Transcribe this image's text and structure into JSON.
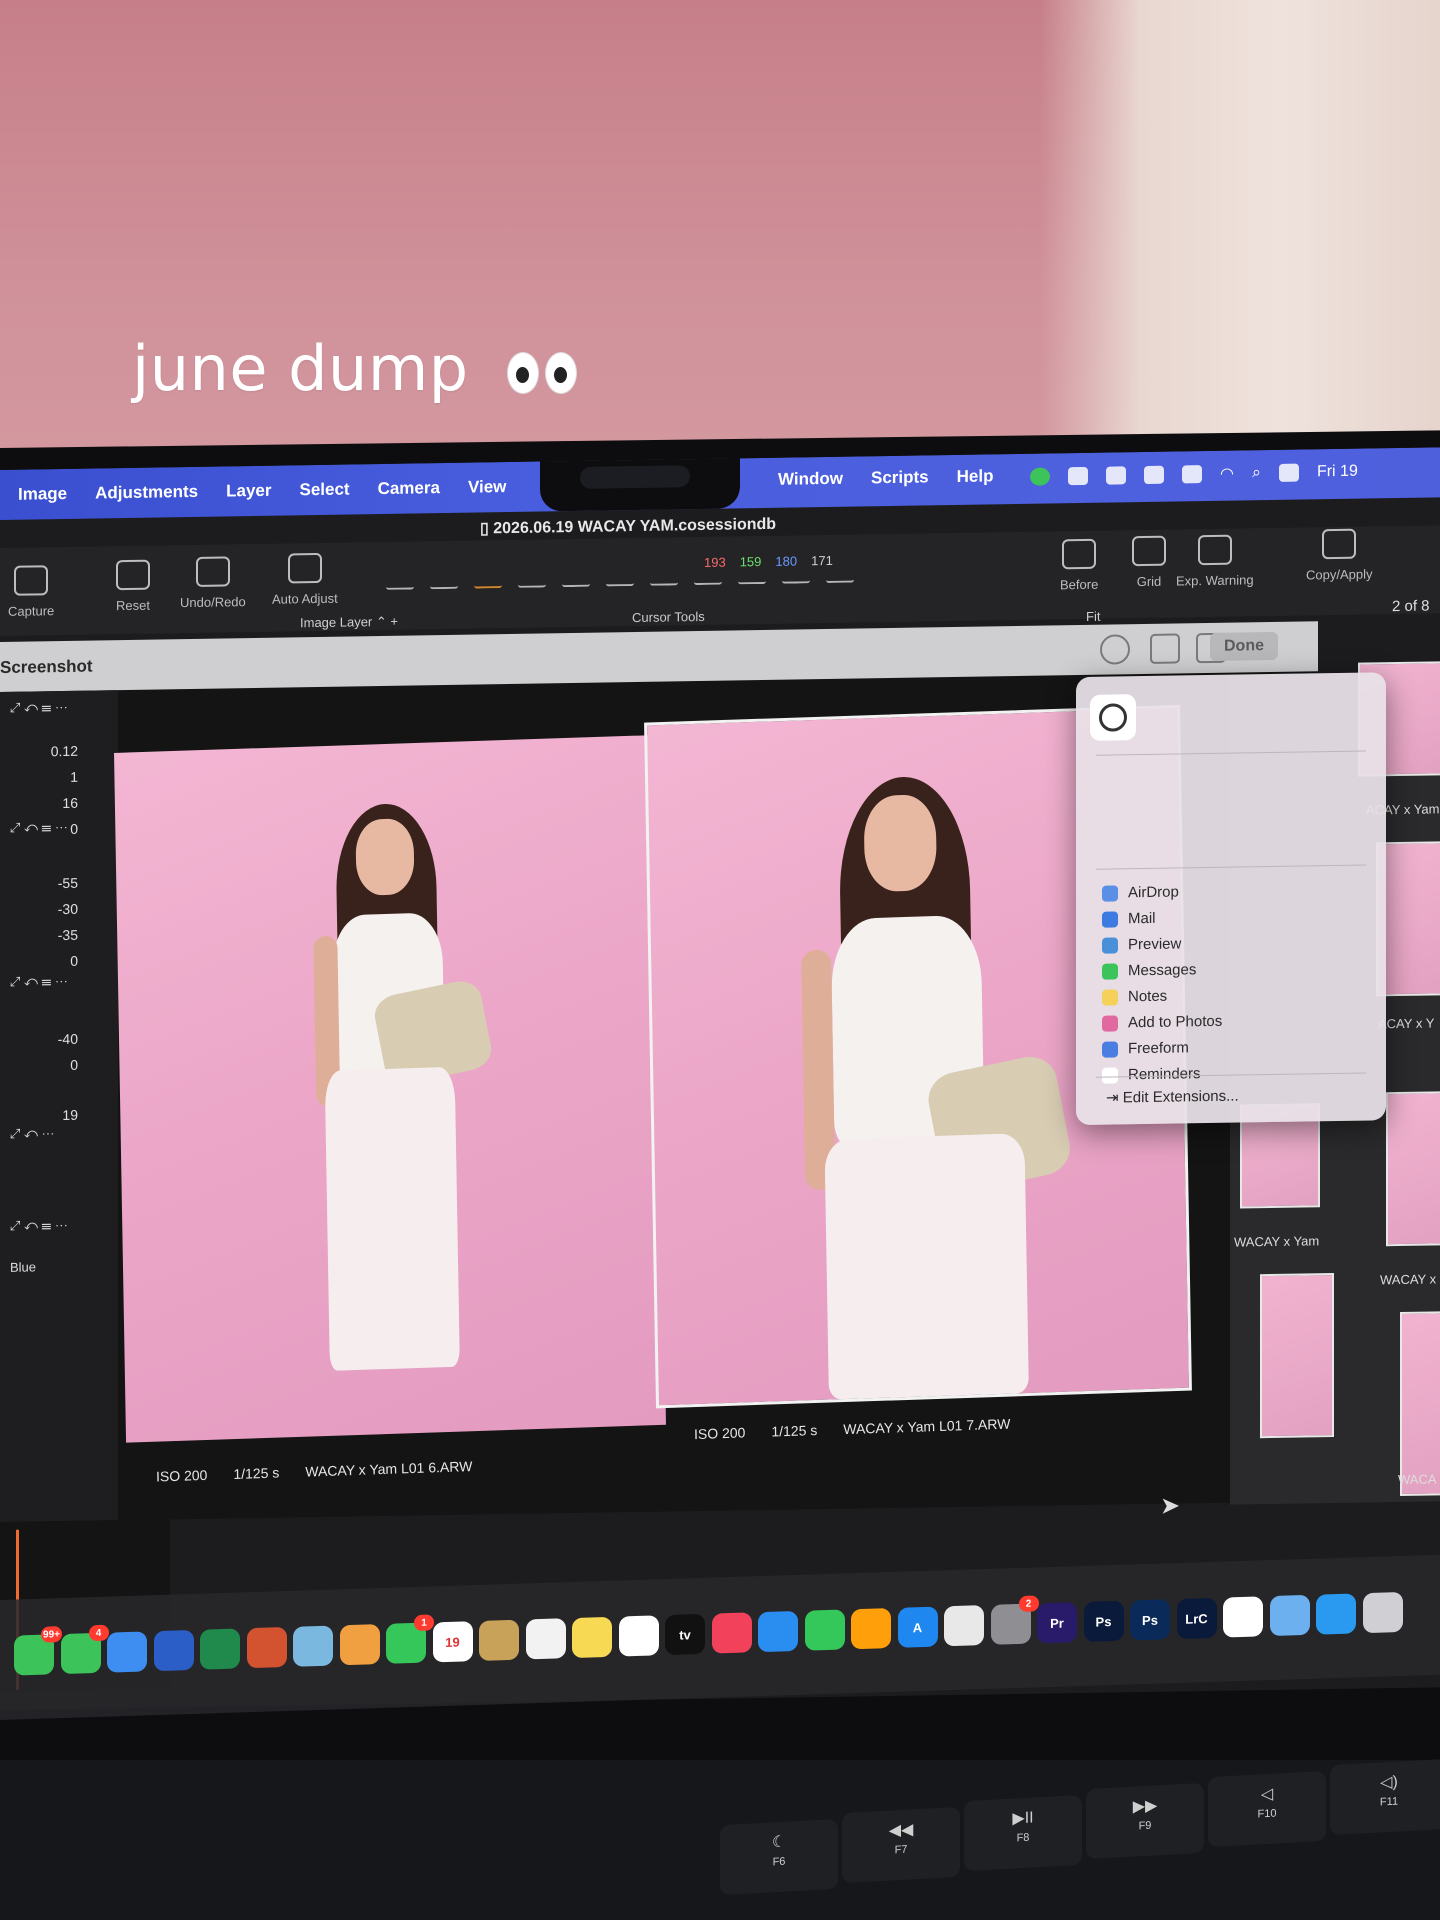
{
  "caption": "june dump",
  "menu": {
    "left": [
      "Image",
      "Adjustments",
      "Layer",
      "Select",
      "Camera",
      "View"
    ],
    "right": [
      "Window",
      "Scripts",
      "Help"
    ],
    "clock": "Fri 19"
  },
  "document_title": "2026.06.19 WACAY YAM.cosessiondb",
  "toolbar": {
    "groups": [
      {
        "label": "Capture"
      },
      {
        "label": "Reset"
      },
      {
        "label": "Undo/Redo"
      },
      {
        "label": "Auto Adjust"
      },
      {
        "label": "Before"
      },
      {
        "label": "Grid"
      },
      {
        "label": "Exp. Warning"
      },
      {
        "label": "Copy/Apply"
      }
    ],
    "cursor_tools_label": "Cursor Tools",
    "rgb_readout": {
      "r": "193",
      "g": "159",
      "b": "180",
      "a": "171"
    },
    "image_layer_label": "Image Layer",
    "fit_label": "Fit",
    "page_count": "2 of 8"
  },
  "viewer": {
    "title": "Screenshot",
    "done_label": "Done",
    "left_values": [
      "0.12",
      "1",
      "16",
      "0",
      "-55",
      "-30",
      "-35",
      "0",
      "-40",
      "0",
      "19"
    ],
    "channel_label": "Blue",
    "photos": [
      {
        "iso": "ISO 200",
        "shutter": "1/125 s",
        "filename": "WACAY x Yam L01 6.ARW"
      },
      {
        "iso": "ISO 200",
        "shutter": "1/125 s",
        "filename": "WACAY x Yam L01 7.ARW"
      }
    ],
    "filmstrip_labels": [
      "ACAY x Yam",
      "ACAY x Y",
      "WACAY x Yam",
      "WACAY x",
      "WACA"
    ]
  },
  "share_menu": {
    "items": [
      {
        "label": "AirDrop",
        "color": "#5a8fe6"
      },
      {
        "label": "Mail",
        "color": "#3d7be0"
      },
      {
        "label": "Preview",
        "color": "#4a90d9"
      },
      {
        "label": "Messages",
        "color": "#3cc35a"
      },
      {
        "label": "Notes",
        "color": "#f5d15a"
      },
      {
        "label": "Add to Photos",
        "color": "#e06aa0"
      },
      {
        "label": "Freeform",
        "color": "#4a7ee0"
      },
      {
        "label": "Reminders",
        "color": "#ffffff"
      }
    ],
    "edit_extensions": "Edit Extensions..."
  },
  "dock": {
    "icons": [
      {
        "name": "line",
        "label": "",
        "color": "#3cc35a",
        "badge": "99+"
      },
      {
        "name": "messages",
        "label": "",
        "color": "#3cc35a",
        "badge": "4"
      },
      {
        "name": "mail",
        "label": "",
        "color": "#3d8ef0",
        "badge": ""
      },
      {
        "name": "word",
        "label": "",
        "color": "#2b5fc7",
        "badge": ""
      },
      {
        "name": "excel",
        "label": "",
        "color": "#1f8a4c",
        "badge": ""
      },
      {
        "name": "powerpoint",
        "label": "",
        "color": "#d35230",
        "badge": ""
      },
      {
        "name": "maps",
        "label": "",
        "color": "#7ab8e0",
        "badge": ""
      },
      {
        "name": "photos",
        "label": "",
        "color": "#f0a040",
        "badge": ""
      },
      {
        "name": "facetime",
        "label": "",
        "color": "#35c759",
        "badge": "1"
      },
      {
        "name": "calendar",
        "label": "19",
        "color": "#ffffff",
        "badge": ""
      },
      {
        "name": "contacts",
        "label": "",
        "color": "#c9a25a",
        "badge": ""
      },
      {
        "name": "reminders",
        "label": "",
        "color": "#f2f2f2",
        "badge": ""
      },
      {
        "name": "notes",
        "label": "",
        "color": "#f7d954",
        "badge": ""
      },
      {
        "name": "freeform",
        "label": "",
        "color": "#ffffff",
        "badge": ""
      },
      {
        "name": "appletv",
        "label": "tv",
        "color": "#111111",
        "badge": ""
      },
      {
        "name": "music",
        "label": "",
        "color": "#f2415a",
        "badge": ""
      },
      {
        "name": "keynote",
        "label": "",
        "color": "#2a8ef0",
        "badge": ""
      },
      {
        "name": "numbers",
        "label": "",
        "color": "#34c759",
        "badge": ""
      },
      {
        "name": "pages",
        "label": "",
        "color": "#ff9f0a",
        "badge": ""
      },
      {
        "name": "appstore",
        "label": "A",
        "color": "#1e88f0",
        "badge": ""
      },
      {
        "name": "captureone",
        "label": "",
        "color": "#e8e8e8",
        "badge": ""
      },
      {
        "name": "settings",
        "label": "",
        "color": "#8e8e93",
        "badge": "2"
      },
      {
        "name": "premiere",
        "label": "Pr",
        "color": "#2a1a6a",
        "badge": ""
      },
      {
        "name": "photoshop",
        "label": "Ps",
        "color": "#0a1a3a",
        "badge": ""
      },
      {
        "name": "photoshop-beta",
        "label": "Ps",
        "color": "#0a2a5a",
        "badge": ""
      },
      {
        "name": "lightroom-classic",
        "label": "LrC",
        "color": "#0a1a3a",
        "badge": ""
      },
      {
        "name": "chrome",
        "label": "",
        "color": "#ffffff",
        "badge": ""
      },
      {
        "name": "preview",
        "label": "",
        "color": "#6cb0f0",
        "badge": ""
      },
      {
        "name": "safari",
        "label": "",
        "color": "#2a9af0",
        "badge": ""
      },
      {
        "name": "trash",
        "label": "",
        "color": "#cfcfd4",
        "badge": ""
      }
    ]
  },
  "keyboard": {
    "keys": [
      {
        "label": "F6",
        "symbol": "☾"
      },
      {
        "label": "F7",
        "symbol": "◀◀"
      },
      {
        "label": "F8",
        "symbol": "▶II"
      },
      {
        "label": "F9",
        "symbol": "▶▶"
      },
      {
        "label": "F10",
        "symbol": "◁"
      },
      {
        "label": "F11",
        "symbol": "◁)"
      }
    ]
  }
}
